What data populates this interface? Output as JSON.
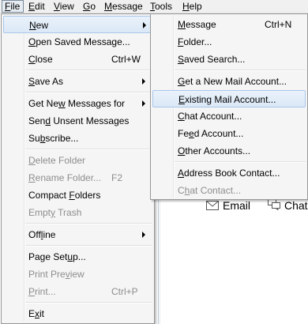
{
  "menubar": {
    "items": [
      {
        "label": "File",
        "accel": "F",
        "rest": "ile"
      },
      {
        "label": "Edit",
        "accel": "E",
        "rest": "dit"
      },
      {
        "label": "View",
        "accel": "V",
        "rest": "iew"
      },
      {
        "label": "Go",
        "accel": "G",
        "rest": "o"
      },
      {
        "label": "Message",
        "accel": "M",
        "rest": "essage"
      },
      {
        "label": "Tools",
        "accel": "T",
        "rest": "ools"
      },
      {
        "label": "Help",
        "accel": "H",
        "rest": "elp"
      }
    ]
  },
  "file_menu": {
    "items": [
      {
        "pre": "",
        "accel": "N",
        "post": "ew",
        "shortcut": ""
      },
      {
        "pre": "",
        "accel": "O",
        "post": "pen Saved Message...",
        "shortcut": ""
      },
      {
        "pre": "",
        "accel": "C",
        "post": "lose",
        "shortcut": "Ctrl+W"
      },
      {
        "pre": "",
        "accel": "S",
        "post": "ave As",
        "shortcut": ""
      },
      {
        "pre": "Get Ne",
        "accel": "w",
        "post": " Messages for",
        "shortcut": ""
      },
      {
        "pre": "Sen",
        "accel": "d",
        "post": " Unsent Messages",
        "shortcut": ""
      },
      {
        "pre": "Su",
        "accel": "b",
        "post": "scribe...",
        "shortcut": ""
      },
      {
        "pre": "",
        "accel": "D",
        "post": "elete Folder",
        "shortcut": ""
      },
      {
        "pre": "",
        "accel": "R",
        "post": "ename Folder...",
        "shortcut": "F2"
      },
      {
        "pre": "Compact ",
        "accel": "F",
        "post": "olders",
        "shortcut": ""
      },
      {
        "pre": "Empt",
        "accel": "y",
        "post": " Trash",
        "shortcut": ""
      },
      {
        "pre": "Off",
        "accel": "l",
        "post": "ine",
        "shortcut": ""
      },
      {
        "pre": "Page Set",
        "accel": "u",
        "post": "p...",
        "shortcut": ""
      },
      {
        "pre": "Print Pre",
        "accel": "v",
        "post": "iew",
        "shortcut": ""
      },
      {
        "pre": "",
        "accel": "P",
        "post": "rint...",
        "shortcut": "Ctrl+P"
      },
      {
        "pre": "E",
        "accel": "x",
        "post": "it",
        "shortcut": ""
      }
    ]
  },
  "new_submenu": {
    "items": [
      {
        "pre": "",
        "accel": "M",
        "post": "essage",
        "shortcut": "Ctrl+N"
      },
      {
        "pre": "",
        "accel": "F",
        "post": "older...",
        "shortcut": ""
      },
      {
        "pre": "",
        "accel": "S",
        "post": "aved Search...",
        "shortcut": ""
      },
      {
        "pre": "",
        "accel": "G",
        "post": "et a New Mail Account...",
        "shortcut": ""
      },
      {
        "pre": "",
        "accel": "E",
        "post": "xisting Mail Account...",
        "shortcut": ""
      },
      {
        "pre": "",
        "accel": "C",
        "post": "hat Account...",
        "shortcut": ""
      },
      {
        "pre": "Fe",
        "accel": "e",
        "post": "d Account...",
        "shortcut": ""
      },
      {
        "pre": "",
        "accel": "O",
        "post": "ther Accounts...",
        "shortcut": ""
      },
      {
        "pre": "",
        "accel": "A",
        "post": "ddress Book Contact...",
        "shortcut": ""
      },
      {
        "pre": "C",
        "accel": "h",
        "post": "at Contact...",
        "shortcut": ""
      }
    ]
  },
  "toolbar": {
    "email_label": "Email",
    "chat_label": "Chat"
  }
}
